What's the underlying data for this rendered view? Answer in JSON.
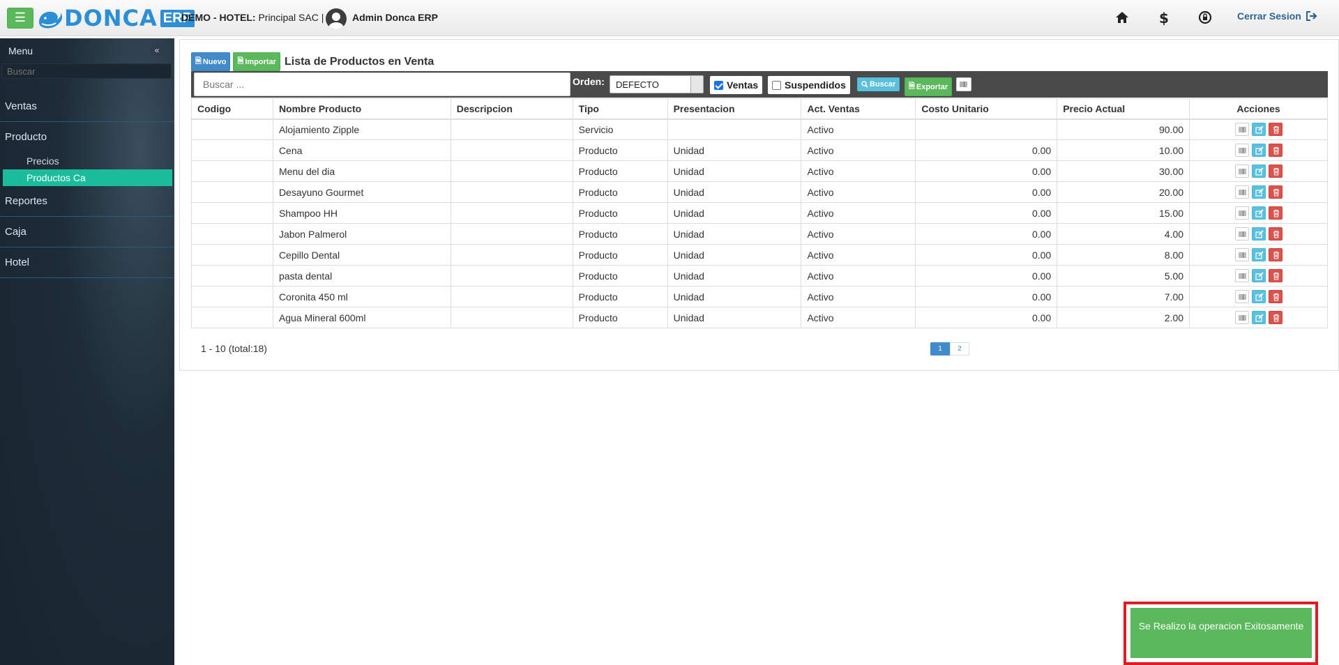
{
  "header": {
    "logo_text": "DONCA",
    "logo_badge": "ERP",
    "company_label": "DEMO - HOTEL:",
    "company_name": "Principal SAC |",
    "username": "Admin Donca ERP",
    "logout_label": "Cerrar Sesion"
  },
  "sidebar": {
    "title": "Menu",
    "search_placeholder": "Buscar",
    "items": [
      {
        "label": "Ventas"
      },
      {
        "label": "Producto"
      },
      {
        "label": "Reportes"
      },
      {
        "label": "Caja"
      },
      {
        "label": "Hotel"
      }
    ],
    "subitems": [
      {
        "label": "Precios"
      },
      {
        "label": "Productos Ca",
        "active": true
      }
    ]
  },
  "main": {
    "new_button": "Nuevo",
    "import_button": "Importar",
    "title": "Lista de Productos en Venta",
    "search_placeholder": "Buscar ...",
    "order_label": "Orden:",
    "order_value": "DEFECTO",
    "ventas_label": "Ventas",
    "ventas_checked": true,
    "suspendidos_label": "Suspendidos",
    "suspendidos_checked": false,
    "search_button": "Buscar",
    "export_button": "Exportar"
  },
  "table": {
    "columns": [
      "Codigo",
      "Nombre Producto",
      "Descripcion",
      "Tipo",
      "Presentacion",
      "Act. Ventas",
      "Costo Unitario",
      "Precio Actual",
      "Acciones"
    ],
    "rows": [
      {
        "codigo": "",
        "nombre": "Alojamiento Zipple",
        "descripcion": "",
        "tipo": "Servicio",
        "presentacion": "",
        "act_ventas": "Activo",
        "costo": "",
        "precio": "90.00"
      },
      {
        "codigo": "",
        "nombre": "Cena",
        "descripcion": "",
        "tipo": "Producto",
        "presentacion": "Unidad",
        "act_ventas": "Activo",
        "costo": "0.00",
        "precio": "10.00"
      },
      {
        "codigo": "",
        "nombre": "Menu del dia",
        "descripcion": "",
        "tipo": "Producto",
        "presentacion": "Unidad",
        "act_ventas": "Activo",
        "costo": "0.00",
        "precio": "30.00"
      },
      {
        "codigo": "",
        "nombre": "Desayuno Gourmet",
        "descripcion": "",
        "tipo": "Producto",
        "presentacion": "Unidad",
        "act_ventas": "Activo",
        "costo": "0.00",
        "precio": "20.00"
      },
      {
        "codigo": "",
        "nombre": "Shampoo HH",
        "descripcion": "",
        "tipo": "Producto",
        "presentacion": "Unidad",
        "act_ventas": "Activo",
        "costo": "0.00",
        "precio": "15.00"
      },
      {
        "codigo": "",
        "nombre": "Jabon Palmerol",
        "descripcion": "",
        "tipo": "Producto",
        "presentacion": "Unidad",
        "act_ventas": "Activo",
        "costo": "0.00",
        "precio": "4.00"
      },
      {
        "codigo": "",
        "nombre": "Cepillo Dental",
        "descripcion": "",
        "tipo": "Producto",
        "presentacion": "Unidad",
        "act_ventas": "Activo",
        "costo": "0.00",
        "precio": "8.00"
      },
      {
        "codigo": "",
        "nombre": "pasta dental",
        "descripcion": "",
        "tipo": "Producto",
        "presentacion": "Unidad",
        "act_ventas": "Activo",
        "costo": "0.00",
        "precio": "5.00"
      },
      {
        "codigo": "",
        "nombre": "Coronita 450 ml",
        "descripcion": "",
        "tipo": "Producto",
        "presentacion": "Unidad",
        "act_ventas": "Activo",
        "costo": "0.00",
        "precio": "7.00"
      },
      {
        "codigo": "",
        "nombre": "Agua Mineral 600ml",
        "descripcion": "",
        "tipo": "Producto",
        "presentacion": "Unidad",
        "act_ventas": "Activo",
        "costo": "0.00",
        "precio": "2.00"
      }
    ]
  },
  "pagination": {
    "range_text": "1 - 10 (total:18)",
    "pages": [
      "1",
      "2"
    ],
    "current": "1"
  },
  "toast": {
    "message": "Se Realizo la operacion Exitosamente"
  },
  "colors": {
    "success": "#5cb85c",
    "primary": "#428bca",
    "info": "#5bc0de",
    "danger": "#d9534f",
    "sidebar_active": "#1abc9c",
    "highlight_frame": "#e01b24"
  }
}
